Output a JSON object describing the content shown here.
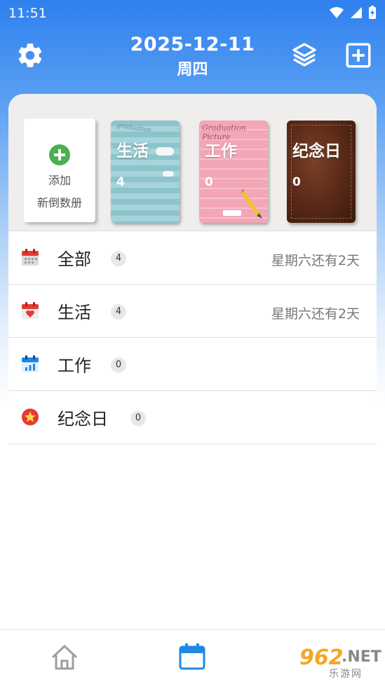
{
  "status_bar": {
    "time": "11:51"
  },
  "header": {
    "date": "2025-12-11",
    "weekday": "周四"
  },
  "books": {
    "add": {
      "line1": "添加",
      "line2": "新倒数册"
    },
    "items": [
      {
        "title": "生活",
        "count": "4",
        "deco": "graduation"
      },
      {
        "title": "工作",
        "count": "0",
        "deco": "Graduation Picture"
      },
      {
        "title": "纪念日",
        "count": "0"
      }
    ]
  },
  "list": [
    {
      "label": "全部",
      "badge": "4",
      "meta": "星期六还有2天",
      "icon": "calendar-grid-icon"
    },
    {
      "label": "生活",
      "badge": "4",
      "meta": "星期六还有2天",
      "icon": "calendar-heart-icon"
    },
    {
      "label": "工作",
      "badge": "0",
      "meta": "",
      "icon": "calendar-chart-icon"
    },
    {
      "label": "纪念日",
      "badge": "0",
      "meta": "",
      "icon": "star-badge-icon"
    }
  ],
  "watermark": {
    "number": "962",
    "net": ".NET",
    "sub": "乐游网"
  },
  "colors": {
    "header_blue": "#2f80ee",
    "add_green": "#4caf50",
    "calendar_red": "#e53935",
    "calendar_blue": "#1e88e5",
    "active_nav": "#1e88e5"
  }
}
